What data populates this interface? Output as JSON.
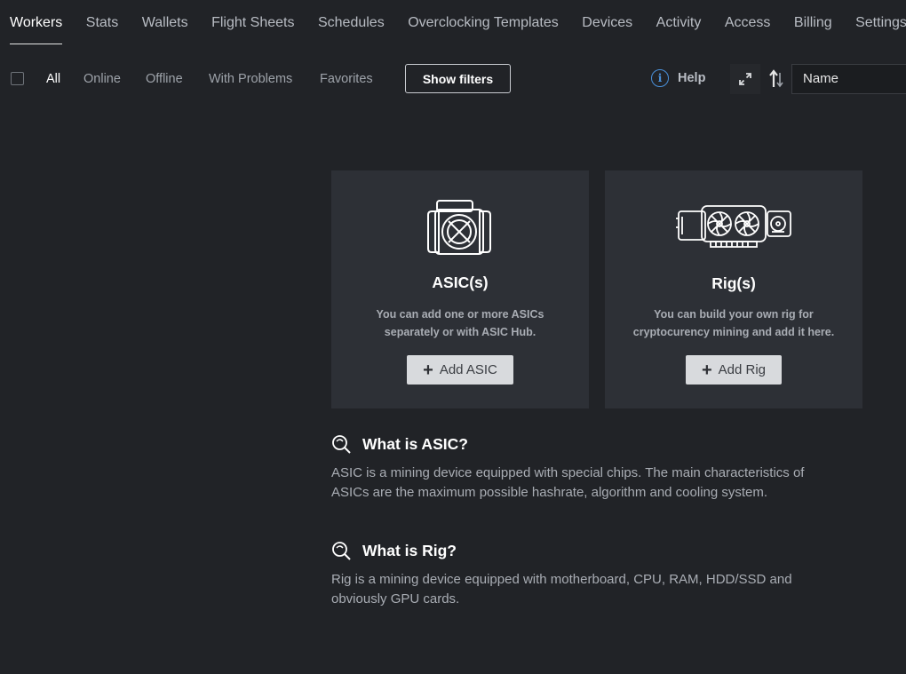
{
  "nav": {
    "items": [
      {
        "label": "Workers",
        "active": true
      },
      {
        "label": "Stats"
      },
      {
        "label": "Wallets"
      },
      {
        "label": "Flight Sheets"
      },
      {
        "label": "Schedules"
      },
      {
        "label": "Overclocking Templates"
      },
      {
        "label": "Devices"
      },
      {
        "label": "Activity"
      },
      {
        "label": "Access"
      },
      {
        "label": "Billing"
      },
      {
        "label": "Settings"
      }
    ]
  },
  "filters": {
    "tabs": [
      {
        "label": "All",
        "active": true
      },
      {
        "label": "Online"
      },
      {
        "label": "Offline"
      },
      {
        "label": "With Problems"
      },
      {
        "label": "Favorites"
      }
    ],
    "show_filters_label": "Show filters",
    "help_label": "Help",
    "help_icon": "i",
    "sort_value": "Name"
  },
  "cards": {
    "asic": {
      "icon": "asic-device-icon",
      "title": "ASIC(s)",
      "desc_line1": "You can add one or more ASICs",
      "desc_line2": "separately or with ASIC Hub.",
      "button_label": "Add ASIC"
    },
    "rig": {
      "icon": "gpu-rig-icon",
      "title": "Rig(s)",
      "desc_line1": "You can build your own rig for",
      "desc_line2": "cryptocurency mining and add it here.",
      "button_label": "Add Rig"
    }
  },
  "info": {
    "asic": {
      "title": "What is ASIC?",
      "line1": "ASIC is a mining device equipped with special chips. The main characteristics of",
      "line2": "ASICs are the maximum possible hashrate, algorithm and cooling system."
    },
    "rig": {
      "title": "What is Rig?",
      "line1": "Rig is a mining device equipped with motherboard, CPU, RAM, HDD/SSD and",
      "line2": "obviously GPU cards."
    }
  },
  "colors": {
    "background": "#212327",
    "card": "#2d3036",
    "accent_blue": "#4a90d9",
    "button": "#d8dadd"
  }
}
